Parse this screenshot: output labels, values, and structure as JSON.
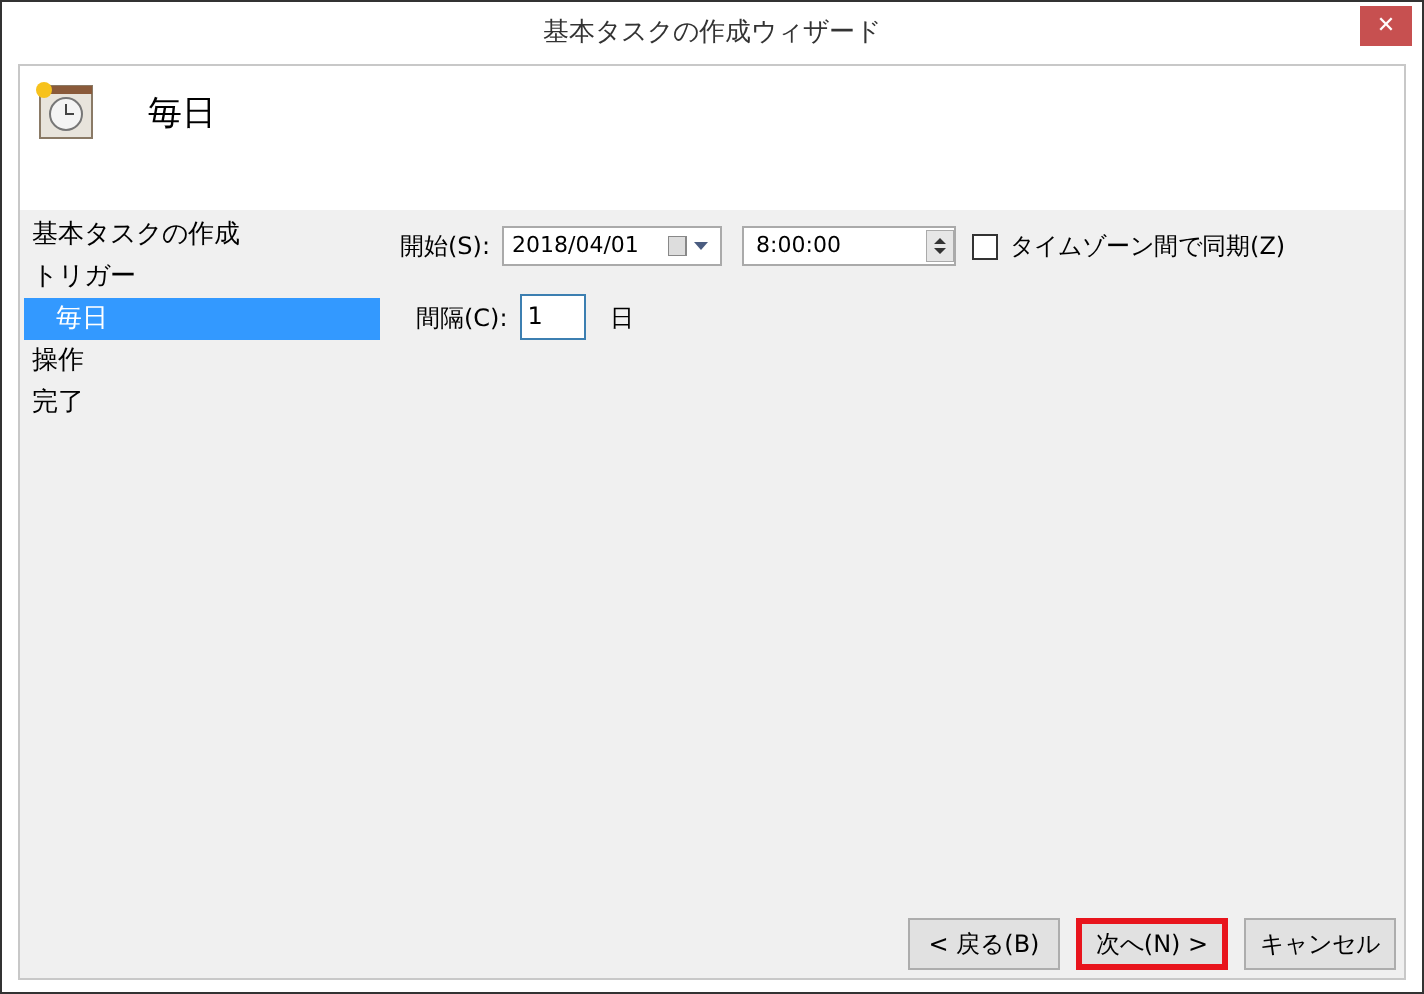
{
  "window": {
    "title": "基本タスクの作成ウィザード",
    "close": "✕"
  },
  "header": {
    "title": "毎日"
  },
  "steps": [
    {
      "label": "基本タスクの作成",
      "selected": false,
      "sub": false
    },
    {
      "label": "トリガー",
      "selected": false,
      "sub": false
    },
    {
      "label": "毎日",
      "selected": true,
      "sub": true
    },
    {
      "label": "操作",
      "selected": false,
      "sub": false
    },
    {
      "label": "完了",
      "selected": false,
      "sub": false
    }
  ],
  "start": {
    "label": "開始(S):",
    "date": "2018/04/01",
    "time": "8:00:00",
    "sync_label": "タイムゾーン間で同期(Z)",
    "sync_checked": false
  },
  "interval": {
    "label": "間隔(C):",
    "value": "1",
    "unit": "日"
  },
  "buttons": [
    {
      "label": "< 戻る(B)",
      "highlighted": false
    },
    {
      "label": "次へ(N) >",
      "highlighted": true
    },
    {
      "label": "キャンセル",
      "highlighted": false
    }
  ]
}
